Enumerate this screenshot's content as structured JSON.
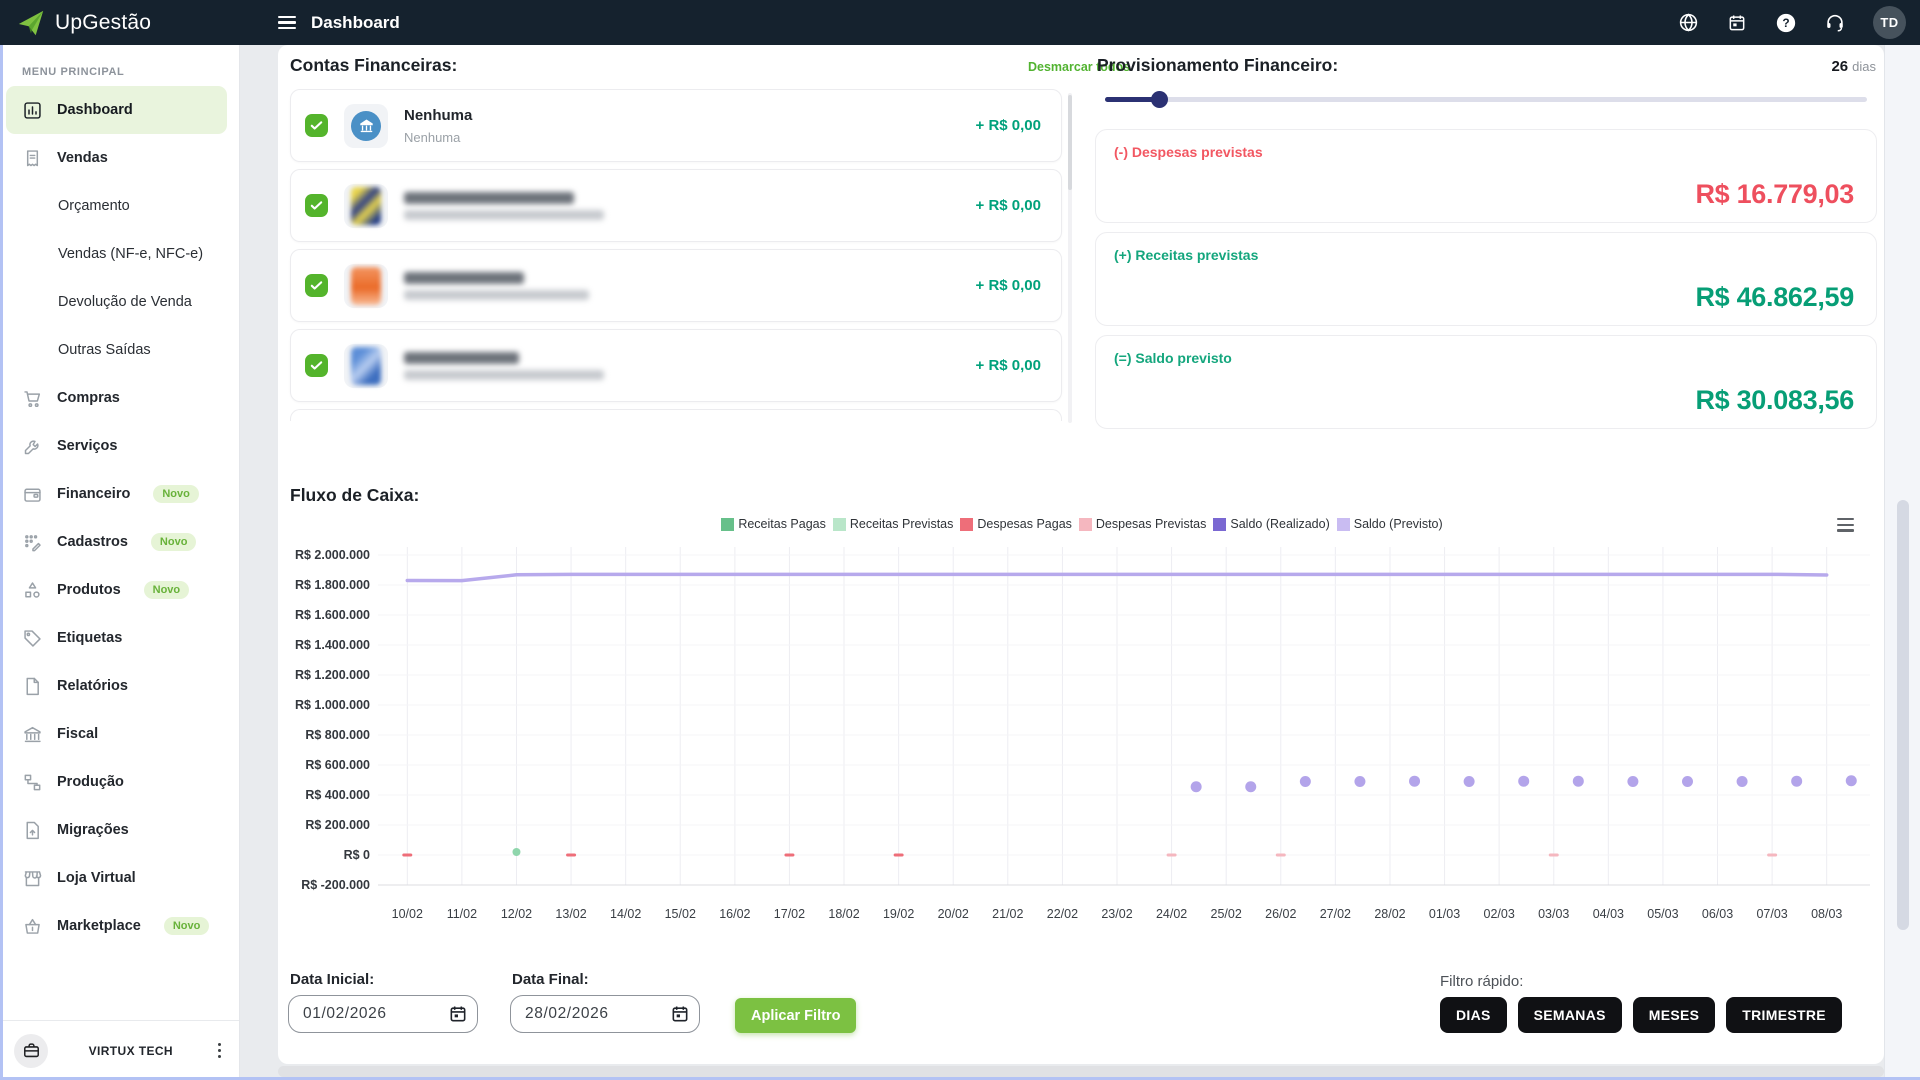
{
  "topbar": {
    "brand": "UpGestão",
    "title": "Dashboard",
    "avatar": "TD",
    "icons": [
      "globe-icon",
      "calendar-icon",
      "help-icon",
      "support-icon"
    ]
  },
  "colors": {
    "brand_green": "#7cc142",
    "topbar_bg": "#15222e",
    "positive": "#079e76",
    "negative": "#ee4f5e",
    "active_menu_bg": "#e9f4dd",
    "checkbox_green": "#54b42c"
  },
  "sidebar": {
    "section": "MENU PRINCIPAL",
    "items": [
      {
        "label": "Dashboard",
        "icon": "dashboard",
        "active": true
      },
      {
        "label": "Vendas",
        "icon": "sales"
      },
      {
        "label": "Orçamento",
        "sub": true
      },
      {
        "label": "Vendas (NF-e, NFC-e)",
        "sub": true
      },
      {
        "label": "Devolução de Venda",
        "sub": true
      },
      {
        "label": "Outras Saídas",
        "sub": true
      },
      {
        "label": "Compras",
        "icon": "cart"
      },
      {
        "label": "Serviços",
        "icon": "wrench"
      },
      {
        "label": "Financeiro",
        "icon": "wallet",
        "badge": "Novo"
      },
      {
        "label": "Cadastros",
        "icon": "records",
        "badge": "Novo"
      },
      {
        "label": "Produtos",
        "icon": "shapes",
        "badge": "Novo"
      },
      {
        "label": "Etiquetas",
        "icon": "tag"
      },
      {
        "label": "Relatórios",
        "icon": "document"
      },
      {
        "label": "Fiscal",
        "icon": "bank"
      },
      {
        "label": "Produção",
        "icon": "flow"
      },
      {
        "label": "Migrações",
        "icon": "file-up"
      },
      {
        "label": "Loja Virtual",
        "icon": "store"
      },
      {
        "label": "Marketplace",
        "icon": "basket",
        "badge": "Novo"
      }
    ],
    "footer": {
      "company": "VIRTUX TECH"
    }
  },
  "accounts": {
    "title": "Contas Financeiras:",
    "deselect_all": "Desmarcar todos",
    "items": [
      {
        "name": "Nenhuma",
        "subtitle": "Nenhuma",
        "amount": "+ R$ 0,00",
        "checked": true,
        "redacted": false,
        "logo": "bank-blue"
      },
      {
        "name": null,
        "subtitle": null,
        "amount": "+ R$ 0,00",
        "checked": true,
        "redacted": true,
        "logo": "yellow-blurred"
      },
      {
        "name": null,
        "subtitle": null,
        "amount": "+ R$ 0,00",
        "checked": true,
        "redacted": true,
        "logo": "orange-blurred"
      },
      {
        "name": null,
        "subtitle": null,
        "amount": "+ R$ 0,00",
        "checked": true,
        "redacted": true,
        "logo": "blue-blurred"
      }
    ]
  },
  "provisioning": {
    "title": "Provisionamento Financeiro:",
    "days_value": "26",
    "days_unit": "dias",
    "slider_pct": 6,
    "cards": [
      {
        "label": "(-) Despesas previstas",
        "value": "R$ 16.779,03",
        "type": "neg"
      },
      {
        "label": "(+) Receitas previstas",
        "value": "R$ 46.862,59",
        "type": "pos"
      },
      {
        "label": "(=) Saldo previsto",
        "value": "R$ 30.083,56",
        "type": "pos"
      }
    ]
  },
  "cashflow": {
    "title": "Fluxo de Caixa:"
  },
  "chart_data": {
    "type": "line",
    "title": "Fluxo de Caixa",
    "x": [
      "10/02",
      "11/02",
      "12/02",
      "13/02",
      "14/02",
      "15/02",
      "16/02",
      "17/02",
      "18/02",
      "19/02",
      "20/02",
      "21/02",
      "22/02",
      "23/02",
      "24/02",
      "25/02",
      "26/02",
      "27/02",
      "28/02",
      "01/03",
      "02/03",
      "03/03",
      "04/03",
      "05/03",
      "06/03",
      "07/03",
      "08/03"
    ],
    "ylim": [
      -200000,
      2000000
    ],
    "ytick_step": 200000,
    "ytick_prefix": "R$",
    "grid": true,
    "legend_position": "top-center",
    "legend": [
      {
        "label": "Receitas Pagas",
        "color": "#67c08a"
      },
      {
        "label": "Receitas Previstas",
        "color": "#b9e6c9"
      },
      {
        "label": "Despesas Pagas",
        "color": "#ee6e79"
      },
      {
        "label": "Despesas Previstas",
        "color": "#f5b7bf"
      },
      {
        "label": "Saldo (Realizado)",
        "color": "#7a68d2"
      },
      {
        "label": "Saldo (Previsto)",
        "color": "#c9bcf2"
      }
    ],
    "series": [
      {
        "name": "Saldo (Previsto)",
        "render": "line",
        "color": "#b7a9ec",
        "width": 3.5,
        "values": [
          1830000,
          1829000,
          1868000,
          1871000,
          1871000,
          1871000,
          1871000,
          1871000,
          1871000,
          1871000,
          1871000,
          1871000,
          1871000,
          1871000,
          1871000,
          1871000,
          1871000,
          1871000,
          1871000,
          1871000,
          1871000,
          1871000,
          1871000,
          1871000,
          1871000,
          1871000,
          1867000
        ]
      },
      {
        "name": "Saldo (Previsto) - pontos",
        "render": "dots",
        "color": "#b3a4ea",
        "radius": 5.5,
        "x_offset": 0.45,
        "values": [
          null,
          null,
          null,
          null,
          null,
          null,
          null,
          null,
          null,
          null,
          null,
          null,
          null,
          null,
          455000,
          455000,
          490000,
          490000,
          492000,
          490000,
          492000,
          492000,
          490000,
          490000,
          490000,
          492000,
          495000
        ]
      },
      {
        "name": "Receitas Pagas",
        "render": "dots",
        "color": "#8fd6ac",
        "radius": 4,
        "values": [
          null,
          null,
          20000,
          null,
          null,
          null,
          null,
          null,
          null,
          null,
          null,
          null,
          null,
          null,
          null,
          null,
          null,
          null,
          null,
          null,
          null,
          null,
          null,
          null,
          null,
          null,
          null
        ]
      },
      {
        "name": "Despesas Pagas",
        "render": "dashes",
        "color": "#ee6e79",
        "values": [
          0,
          null,
          null,
          0,
          null,
          null,
          null,
          0,
          null,
          0,
          null,
          null,
          null,
          null,
          null,
          null,
          null,
          null,
          null,
          null,
          null,
          null,
          null,
          null,
          null,
          null,
          null
        ]
      },
      {
        "name": "Despesas Previstas",
        "render": "dashes",
        "color": "#f5b7bf",
        "values": [
          null,
          null,
          null,
          null,
          null,
          null,
          null,
          null,
          null,
          null,
          null,
          null,
          null,
          null,
          0,
          null,
          0,
          null,
          null,
          null,
          null,
          0,
          null,
          null,
          null,
          0,
          null
        ]
      }
    ]
  },
  "filters": {
    "start_label": "Data Inicial:",
    "start_value": "01/02/2026",
    "end_label": "Data Final:",
    "end_value": "28/02/2026",
    "apply_label": "Aplicar Filtro",
    "quick_label": "Filtro rápido:",
    "quick": [
      "DIAS",
      "SEMANAS",
      "MESES",
      "TRIMESTRE"
    ]
  }
}
